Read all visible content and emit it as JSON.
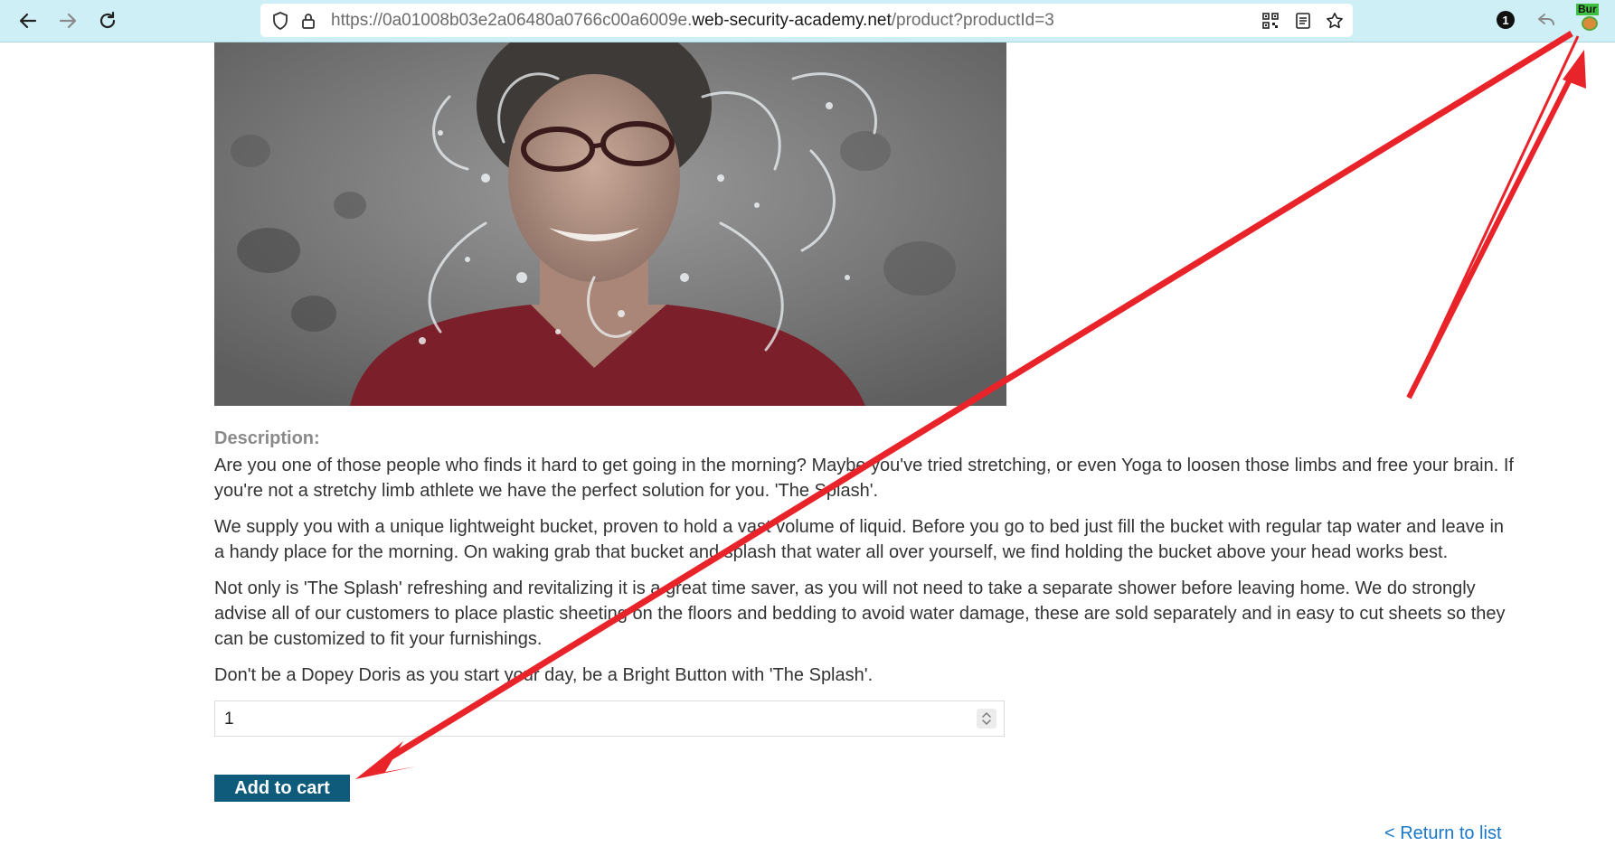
{
  "browser": {
    "url_prefix": "https://0a01008b03e2a06480a0766c00a6009e.",
    "url_domain": "web-security-academy.net",
    "url_path": "/product?productId=3",
    "notification_count": "1",
    "extension_label": "Bur",
    "icons": [
      "back-arrow-icon",
      "forward-arrow-icon",
      "reload-icon",
      "shield-icon",
      "lock-icon",
      "qr-code-icon",
      "reader-view-icon",
      "bookmark-star-icon",
      "reply-arrow-icon",
      "burp-extension-icon"
    ]
  },
  "product": {
    "image_alt": "woman splashed with water",
    "description_heading": "Description:",
    "paragraphs": [
      "Are you one of those people who finds it hard to get going in the morning? Maybe you've tried stretching, or even Yoga to loosen those limbs and free your brain. If you're not a stretchy limb athlete we have the perfect solution for you. 'The Splash'.",
      "We supply you with a unique lightweight bucket, proven to hold a vast volume of liquid. Before you go to bed just fill the bucket with regular tap water and leave in a handy place for the morning. On waking grab that bucket and splash that water all over yourself, we find holding the bucket above your head works best.",
      "Not only is 'The Splash' refreshing and revitalizing it is a great time saver, as you will not need to take a separate shower before leaving home. We do strongly advise all of our customers to place plastic sheeting on the floors and bedding to avoid water damage, these are sold separately and in easy to cut sheets so they can be customized to fit your furnishings.",
      "Don't be a Dopey Doris as you start your day, be a Bright Button with 'The Splash'."
    ],
    "quantity": "1",
    "add_to_cart_label": "Add to cart",
    "return_link_label": "< Return to list"
  },
  "colors": {
    "toolbar_bg": "#cfeff6",
    "button_bg": "#0f5b7c",
    "link": "#1877c9",
    "annotation_arrow": "#e8232a"
  }
}
